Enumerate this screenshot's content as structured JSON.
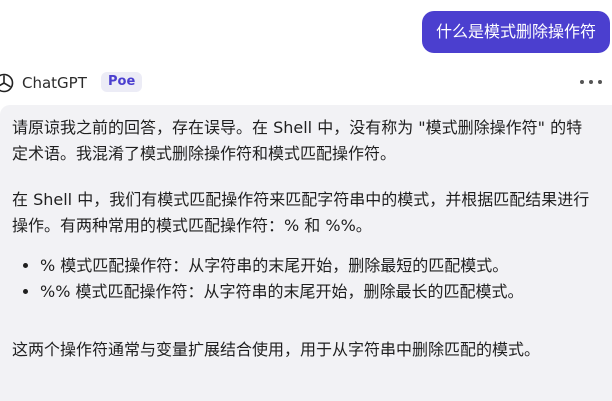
{
  "user_message": "什么是模式删除操作符",
  "bot": {
    "name": "ChatGPT",
    "badge": "Poe",
    "more_icon": "more-horizontal-icon",
    "avatar_icon": "openai-logo-icon"
  },
  "reply": {
    "paragraph1": "请原谅我之前的回答，存在误导。在 Shell 中，没有称为 \"模式删除操作符\" 的特定术语。我混淆了模式删除操作符和模式匹配操作符。",
    "paragraph2": "在 Shell 中，我们有模式匹配操作符来匹配字符串中的模式，并根据匹配结果进行操作。有两种常用的模式匹配操作符：% 和 %%。",
    "bullets": [
      "% 模式匹配操作符：从字符串的末尾开始，删除最短的匹配模式。",
      "%% 模式匹配操作符：从字符串的末尾开始，删除最长的匹配模式。"
    ],
    "paragraph3": "这两个操作符通常与变量扩展结合使用，用于从字符串中删除匹配的模式。"
  },
  "colors": {
    "user_bubble": "#4b3fcf",
    "card_background": "#f2f2f5",
    "badge_text": "#4b3fcf"
  }
}
